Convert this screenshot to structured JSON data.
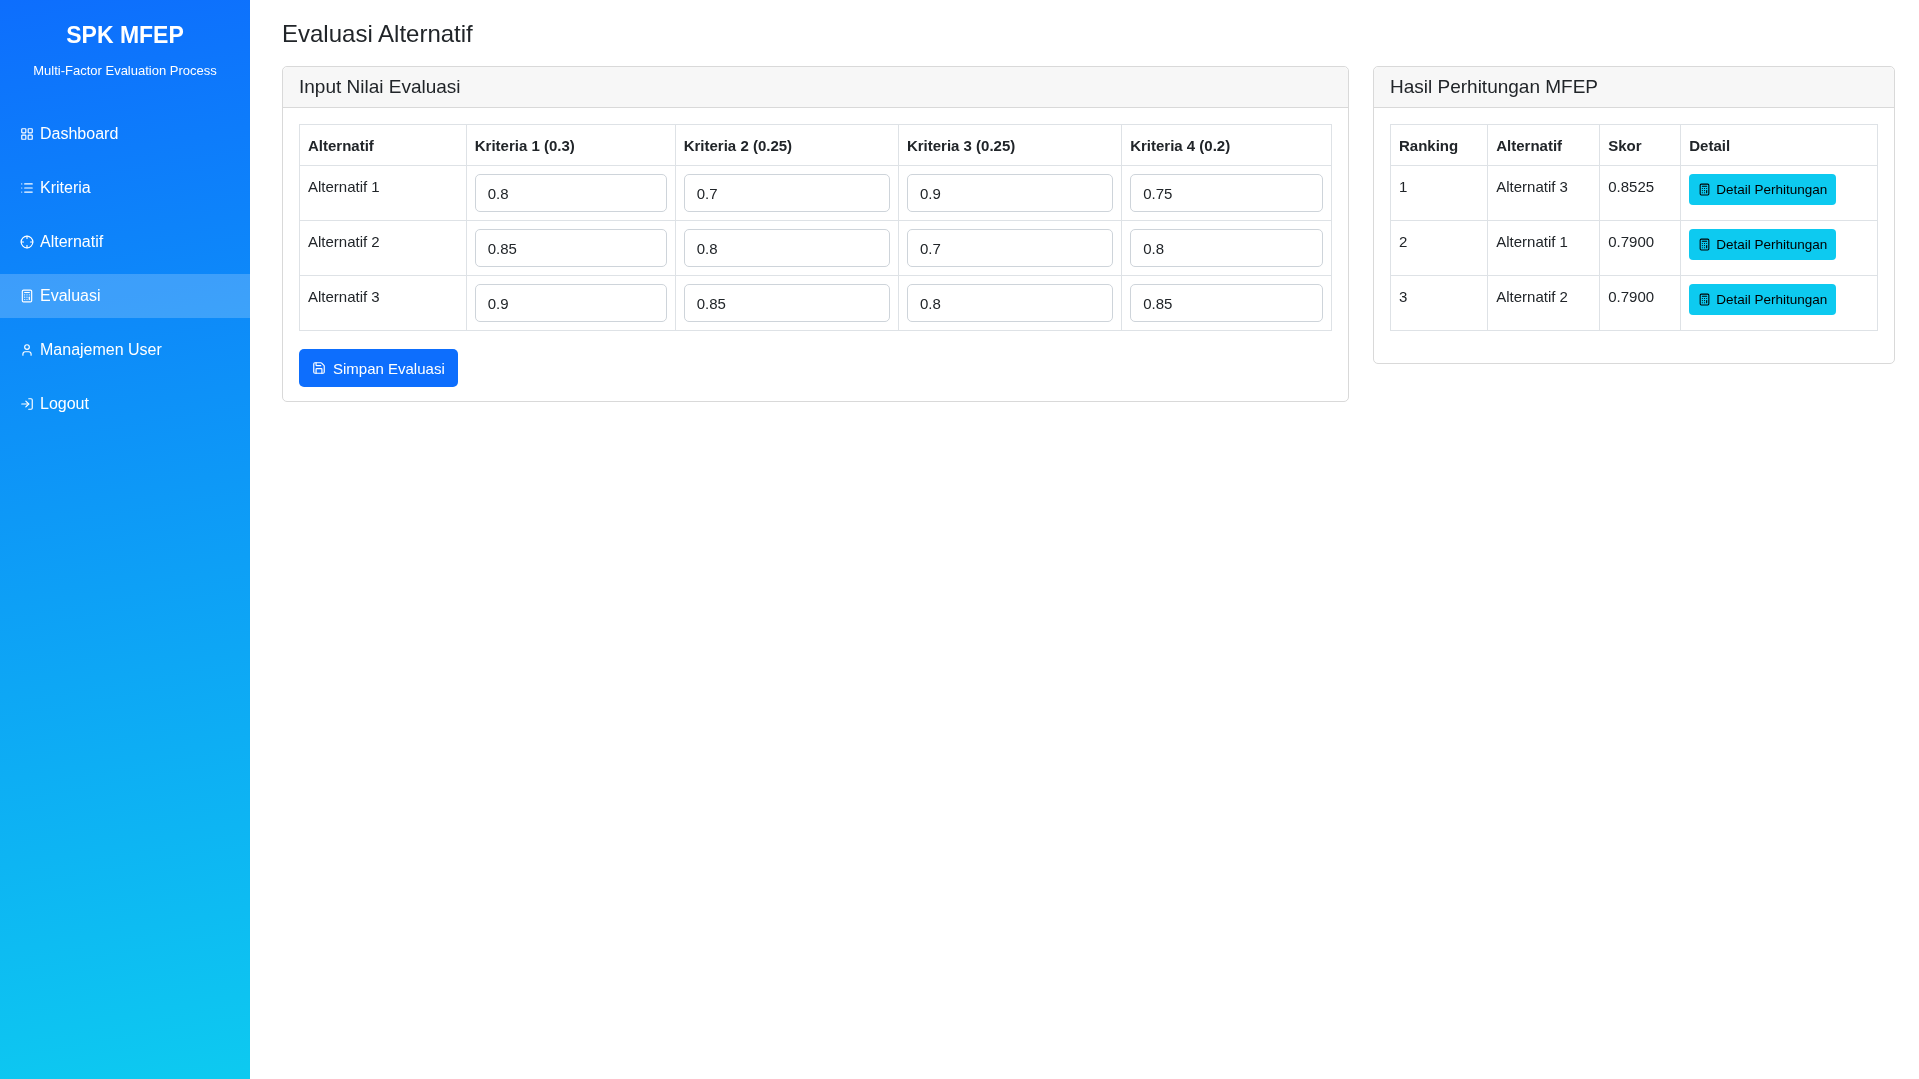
{
  "sidebar": {
    "title": "SPK MFEP",
    "subtitle": "Multi-Factor Evaluation Process",
    "items": [
      {
        "label": "Dashboard",
        "kind": "dashboard",
        "selected": false
      },
      {
        "label": "Kriteria",
        "kind": "list",
        "selected": false
      },
      {
        "label": "Alternatif",
        "kind": "target",
        "selected": false
      },
      {
        "label": "Evaluasi",
        "kind": "calculator",
        "selected": true
      },
      {
        "label": "Manajemen User",
        "kind": "user",
        "selected": false
      },
      {
        "label": "Logout",
        "kind": "logout",
        "selected": false
      }
    ]
  },
  "page_title": "Evaluasi Alternatif",
  "input_card": {
    "title": "Input Nilai Evaluasi",
    "columns": [
      "Alternatif",
      "Kriteria 1 (0.3)",
      "Kriteria 2 (0.25)",
      "Kriteria 3 (0.25)",
      "Kriteria 4 (0.2)"
    ],
    "rows": [
      {
        "name": "Alternatif 1",
        "values": [
          "0.8",
          "0.7",
          "0.9",
          "0.75"
        ]
      },
      {
        "name": "Alternatif 2",
        "values": [
          "0.85",
          "0.8",
          "0.7",
          "0.8"
        ]
      },
      {
        "name": "Alternatif 3",
        "values": [
          "0.9",
          "0.85",
          "0.8",
          "0.85"
        ]
      }
    ],
    "save_button": "Simpan Evaluasi"
  },
  "result_card": {
    "title": "Hasil Perhitungan MFEP",
    "columns": [
      "Ranking",
      "Alternatif",
      "Skor",
      "Detail"
    ],
    "rows": [
      {
        "ranking": "1",
        "alternative": "Alternatif 3",
        "score": "0.8525",
        "button": "Detail Perhitungan"
      },
      {
        "ranking": "2",
        "alternative": "Alternatif 1",
        "score": "0.7900",
        "button": "Detail Perhitungan"
      },
      {
        "ranking": "3",
        "alternative": "Alternatif 2",
        "score": "0.7900",
        "button": "Detail Perhitungan"
      }
    ]
  }
}
